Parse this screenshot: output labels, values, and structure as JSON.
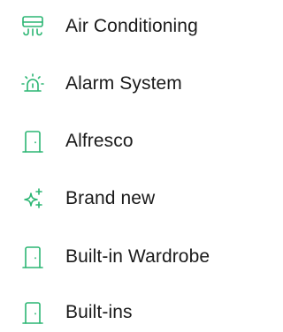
{
  "accent_color": "#2bb673",
  "features": [
    {
      "icon": "air-conditioner-icon",
      "label": "Air Conditioning"
    },
    {
      "icon": "alarm-siren-icon",
      "label": "Alarm System"
    },
    {
      "icon": "door-icon",
      "label": "Alfresco"
    },
    {
      "icon": "sparkles-icon",
      "label": "Brand new"
    },
    {
      "icon": "door-icon",
      "label": "Built-in Wardrobe"
    },
    {
      "icon": "door-icon",
      "label": "Built-ins"
    }
  ]
}
